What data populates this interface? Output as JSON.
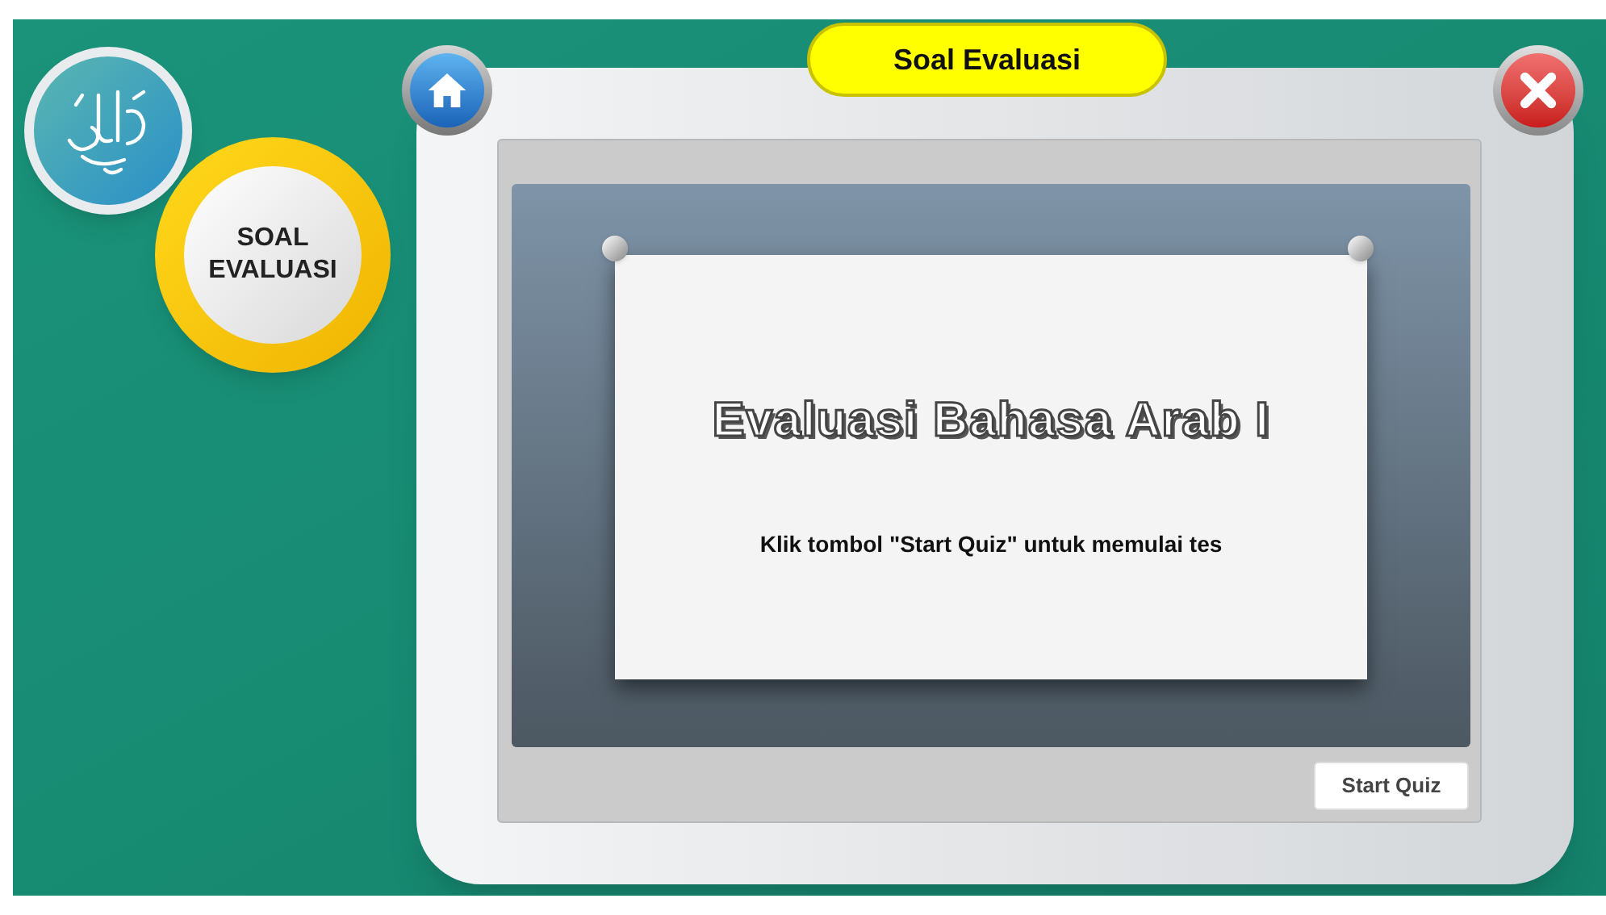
{
  "title": "Soal Evaluasi",
  "menu_badge": {
    "label": "SOAL EVALUASI"
  },
  "slide": {
    "heading": "Evaluasi Bahasa Arab I",
    "instruction": "Klik tombol \"Start Quiz\" untuk memulai tes"
  },
  "buttons": [
    "Start Quiz"
  ]
}
